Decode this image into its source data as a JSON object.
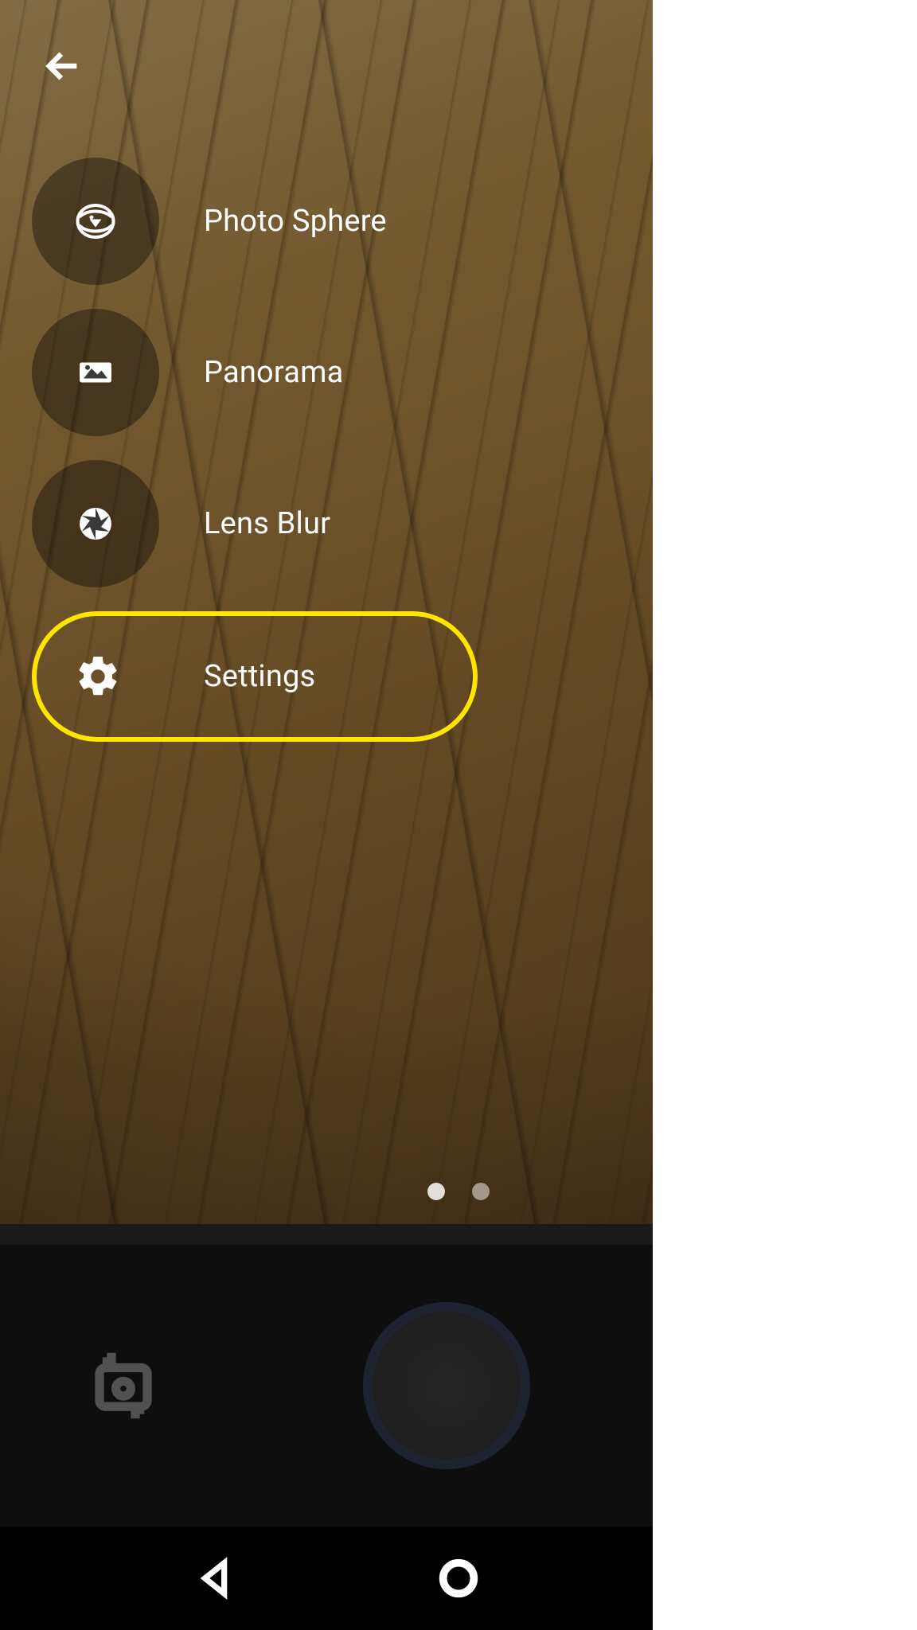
{
  "menu": {
    "items": [
      {
        "id": "photo-sphere",
        "label": "Photo Sphere",
        "icon": "photosphere-icon",
        "highlighted": false
      },
      {
        "id": "panorama",
        "label": "Panorama",
        "icon": "panorama-icon",
        "highlighted": false
      },
      {
        "id": "lens-blur",
        "label": "Lens Blur",
        "icon": "aperture-icon",
        "highlighted": false
      },
      {
        "id": "settings",
        "label": "Settings",
        "icon": "gear-icon",
        "highlighted": true
      }
    ]
  },
  "pagination": {
    "page_count": 2,
    "active_index": 0
  },
  "highlight_color": "#ffe600"
}
